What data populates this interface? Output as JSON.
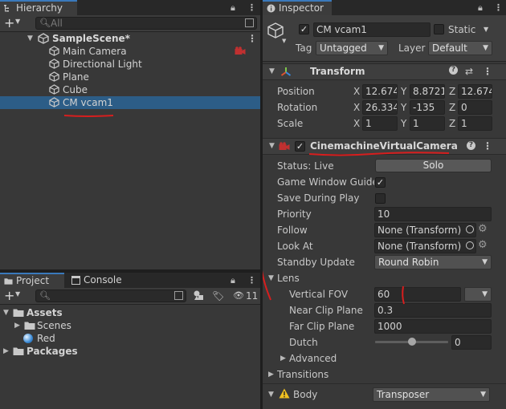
{
  "hierarchy": {
    "tab": "Hierarchy",
    "add_label": "+",
    "search_placeholder": "All",
    "scene": "SampleScene*",
    "items": [
      "Main Camera",
      "Directional Light",
      "Plane",
      "Cube",
      "CM vcam1"
    ],
    "selected": "CM vcam1"
  },
  "project": {
    "tabs": [
      "Project",
      "Console"
    ],
    "add_label": "+",
    "hidden_count": "11",
    "tree": [
      {
        "label": "Assets",
        "bold": true
      },
      {
        "label": "Scenes",
        "bold": false
      },
      {
        "label": "Red",
        "bold": false
      },
      {
        "label": "Packages",
        "bold": true
      }
    ]
  },
  "inspector": {
    "tab": "Inspector",
    "object": {
      "name": "CM vcam1",
      "static_label": "Static",
      "tag_label": "Tag",
      "tag": "Untagged",
      "layer_label": "Layer",
      "layer": "Default"
    },
    "transform": {
      "title": "Transform",
      "rows": [
        {
          "label": "Position",
          "x": "12.674",
          "y": "8.8721",
          "z": "12.674"
        },
        {
          "label": "Rotation",
          "x": "26.334",
          "y": "-135",
          "z": "0"
        },
        {
          "label": "Scale",
          "x": "1",
          "y": "1",
          "z": "1"
        }
      ],
      "axes": [
        "X",
        "Y",
        "Z"
      ]
    },
    "cinemachine": {
      "title": "CinemachineVirtualCamera",
      "status_label": "Status: Live",
      "solo_label": "Solo",
      "game_window_guides": "Game Window Guides",
      "save_during_play": "Save During Play",
      "priority_label": "Priority",
      "priority": "10",
      "follow_label": "Follow",
      "follow": "None (Transform)",
      "lookat_label": "Look At",
      "lookat": "None (Transform)",
      "standby_label": "Standby Update",
      "standby": "Round Robin",
      "lens_label": "Lens",
      "vfov_label": "Vertical FOV",
      "vfov": "60",
      "near_label": "Near Clip Plane",
      "near": "0.3",
      "far_label": "Far Clip Plane",
      "far": "1000",
      "dutch_label": "Dutch",
      "dutch": "0",
      "dutch_fraction": 0.5,
      "advanced_label": "Advanced",
      "transitions_label": "Transitions",
      "body_label": "Body",
      "body": "Transposer"
    }
  }
}
